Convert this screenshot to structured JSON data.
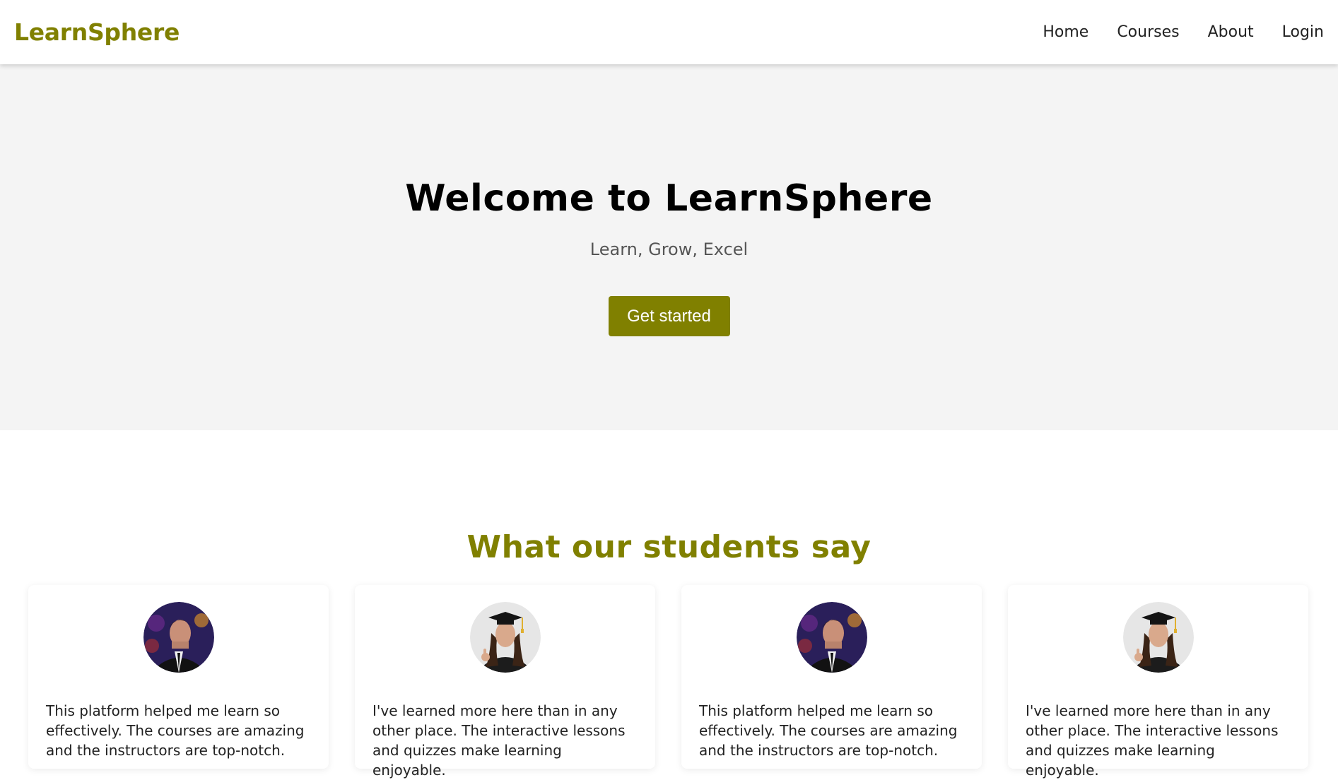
{
  "header": {
    "brand": "LearnSphere",
    "nav": [
      "Home",
      "Courses",
      "About",
      "Login"
    ]
  },
  "hero": {
    "title": "Welcome to LearnSphere",
    "subtitle": "Learn, Grow, Excel",
    "cta": "Get started"
  },
  "testimonials": {
    "title": "What our students say",
    "cards": [
      {
        "avatar": "student-male-avatar",
        "quote": "This platform helped me learn so effectively. The courses are amazing and the instructors are top-notch."
      },
      {
        "avatar": "student-female-graduate-avatar",
        "quote": "I've learned more here than in any other place. The interactive lessons and quizzes make learning enjoyable."
      },
      {
        "avatar": "student-male-avatar",
        "quote": "This platform helped me learn so effectively. The courses are amazing and the instructors are top-notch."
      },
      {
        "avatar": "student-female-graduate-avatar",
        "quote": "I've learned more here than in any other place. The interactive lessons and quizzes make learning enjoyable."
      }
    ]
  },
  "colors": {
    "accent": "#808000",
    "hero_bg": "#f4f4f4"
  }
}
